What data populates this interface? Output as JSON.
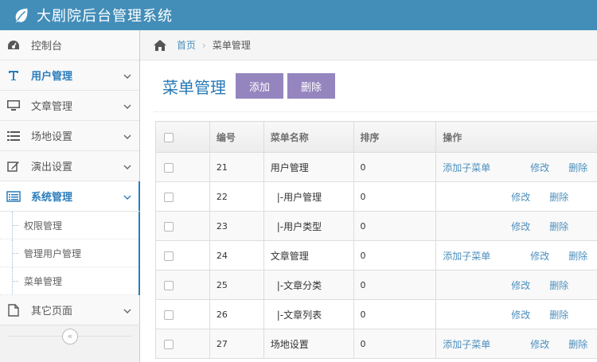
{
  "app": {
    "title": "大剧院后台管理系统"
  },
  "sidebar": {
    "items": [
      {
        "label": "控制台",
        "icon": "dashboard-icon"
      },
      {
        "label": "用户管理",
        "icon": "text-icon"
      },
      {
        "label": "文章管理",
        "icon": "desktop-icon"
      },
      {
        "label": "场地设置",
        "icon": "list-icon"
      },
      {
        "label": "演出设置",
        "icon": "edit-icon"
      },
      {
        "label": "系统管理",
        "icon": "list-alt-icon"
      },
      {
        "label": "其它页面",
        "icon": "file-icon"
      }
    ],
    "submenu": [
      {
        "label": "权限管理"
      },
      {
        "label": "管理用户管理"
      },
      {
        "label": "菜单管理"
      }
    ],
    "collapse_glyph": "«"
  },
  "breadcrumb": {
    "home": "首页",
    "current": "菜单管理",
    "separator": "›"
  },
  "page": {
    "title": "菜单管理",
    "add_label": "添加",
    "delete_label": "删除"
  },
  "table": {
    "headers": {
      "id": "编号",
      "name": "菜单名称",
      "sort": "排序",
      "ops": "操作"
    },
    "add_child_label": "添加子菜单",
    "edit_label": "修改",
    "delete_label": "删除",
    "rows": [
      {
        "id": "21",
        "name": "用户管理",
        "sort": "0"
      },
      {
        "id": "22",
        "name": "|-用户管理",
        "sort": "0"
      },
      {
        "id": "23",
        "name": "|-用户类型",
        "sort": "0"
      },
      {
        "id": "24",
        "name": "文章管理",
        "sort": "0"
      },
      {
        "id": "25",
        "name": "|-文章分类",
        "sort": "0"
      },
      {
        "id": "26",
        "name": "|-文章列表",
        "sort": "0"
      },
      {
        "id": "27",
        "name": "场地设置",
        "sort": "0"
      }
    ]
  },
  "colors": {
    "navbar": "#438eb9",
    "accent": "#2b7dbc",
    "button": "#9585bf",
    "link": "#4c8fbd"
  }
}
